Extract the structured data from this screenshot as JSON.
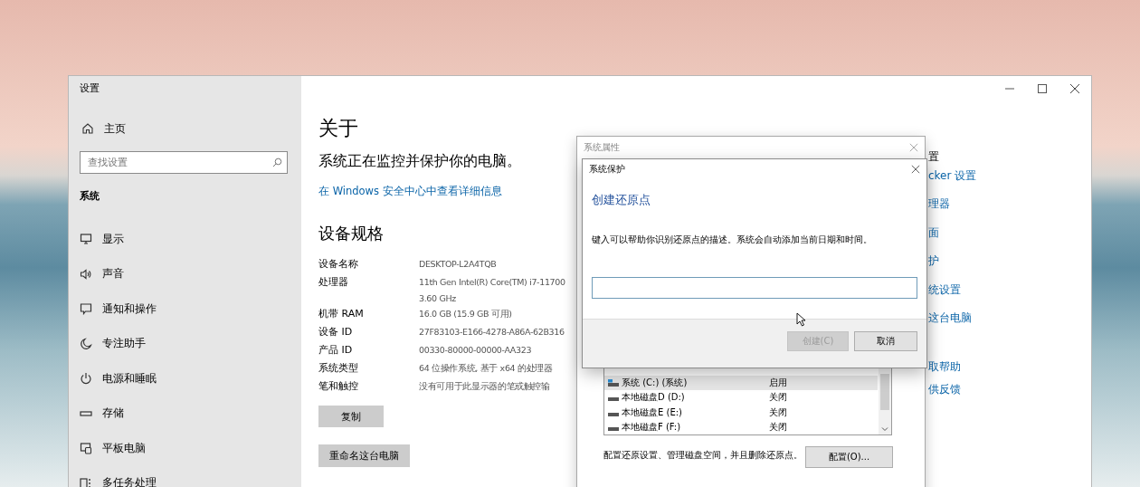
{
  "settings_window": {
    "title": "设置"
  },
  "sidebar": {
    "home": "主页",
    "search": {
      "placeholder": "查找设置"
    },
    "section": "系统",
    "items": [
      {
        "label": "显示"
      },
      {
        "label": "声音"
      },
      {
        "label": "通知和操作"
      },
      {
        "label": "专注助手"
      },
      {
        "label": "电源和睡眠"
      },
      {
        "label": "存储"
      },
      {
        "label": "平板电脑"
      },
      {
        "label": "多任务处理"
      }
    ]
  },
  "main": {
    "title": "关于",
    "status": "系统正在监控并保护你的电脑。",
    "link": "在 Windows 安全中心中查看详细信息",
    "specs_heading": "设备规格",
    "specs": [
      {
        "label": "设备名称",
        "lines": [
          "DESKTOP-L2A4TQB"
        ]
      },
      {
        "label": "处理器",
        "lines": [
          "11th Gen Intel(R) Core(TM) i7-11700",
          "3.60 GHz"
        ]
      },
      {
        "label": "机带 RAM",
        "lines": [
          "16.0 GB (15.9 GB 可用)"
        ]
      },
      {
        "label": "设备 ID",
        "lines": [
          "27F83103-E166-4278-A86A-62B316"
        ]
      },
      {
        "label": "产品 ID",
        "lines": [
          "00330-80000-00000-AA323"
        ]
      },
      {
        "label": "系统类型",
        "lines": [
          "64 位操作系统, 基于 x64 的处理器"
        ]
      },
      {
        "label": "笔和触控",
        "lines": [
          "没有可用于此显示器的笔或触控输"
        ]
      }
    ],
    "buttons": [
      "复制",
      "重命名这台电脑"
    ]
  },
  "related": {
    "heading": "置",
    "links": [
      "cker 设置",
      "理器",
      "面",
      "护",
      "统设置",
      "这台电脑"
    ],
    "help_links": [
      "取帮助",
      "供反馈"
    ]
  },
  "system_properties": {
    "title": "系统属性",
    "drives": [
      {
        "name": "系统 (C:) (系统)",
        "protection": "启用",
        "kind": "system",
        "selected": true
      },
      {
        "name": "本地磁盘D (D:)",
        "protection": "关闭",
        "kind": "local",
        "selected": false
      },
      {
        "name": "本地磁盘E (E:)",
        "protection": "关闭",
        "kind": "local",
        "selected": false
      },
      {
        "name": "本地磁盘F (F:)",
        "protection": "关闭",
        "kind": "local",
        "selected": false
      }
    ],
    "config_text": "配置还原设置、管理磁盘空间，并且删除还原点。",
    "config_button": "配置(O)..."
  },
  "protection_dialog": {
    "title": "系统保护",
    "heading": "创建还原点",
    "description": "键入可以帮助你识别还原点的描述。系统会自动添加当前日期和时间。",
    "buttons": [
      {
        "label": "创建(C)",
        "disabled": true
      },
      {
        "label": "取消",
        "disabled": false
      }
    ]
  }
}
